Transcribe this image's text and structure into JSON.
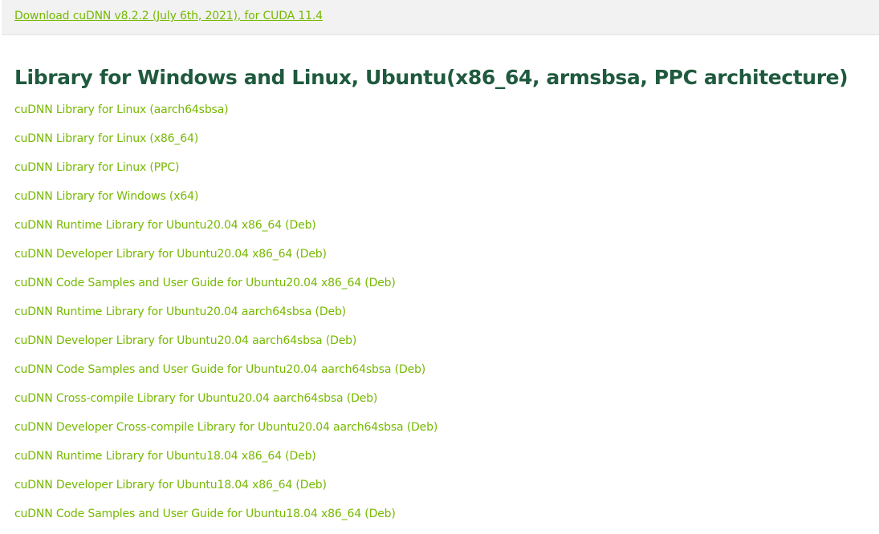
{
  "top_bar": {
    "download_link": "Download cuDNN v8.2.2 (July 6th, 2021), for CUDA 11.4"
  },
  "section": {
    "title": "Library for Windows and Linux, Ubuntu(x86_64, armsbsa, PPC architecture)"
  },
  "links": [
    "cuDNN Library for Linux (aarch64sbsa)",
    "cuDNN Library for Linux (x86_64)",
    "cuDNN Library for Linux (PPC)",
    "cuDNN Library for Windows (x64)",
    "cuDNN Runtime Library for Ubuntu20.04 x86_64 (Deb)",
    "cuDNN Developer Library for Ubuntu20.04 x86_64 (Deb)",
    "cuDNN Code Samples and User Guide for Ubuntu20.04 x86_64 (Deb)",
    "cuDNN Runtime Library for Ubuntu20.04 aarch64sbsa (Deb)",
    "cuDNN Developer Library for Ubuntu20.04 aarch64sbsa (Deb)",
    "cuDNN Code Samples and User Guide for Ubuntu20.04 aarch64sbsa (Deb)",
    "cuDNN Cross-compile Library for Ubuntu20.04 aarch64sbsa (Deb)",
    "cuDNN Developer Cross-compile Library for Ubuntu20.04 aarch64sbsa (Deb)",
    "cuDNN Runtime Library for Ubuntu18.04 x86_64 (Deb)",
    "cuDNN Developer Library for Ubuntu18.04 x86_64 (Deb)",
    "cuDNN Code Samples and User Guide for Ubuntu18.04 x86_64 (Deb)"
  ],
  "colors": {
    "link": "#76b900",
    "title": "#1f5a3e",
    "top_bar_bg": "#f2f2f2"
  }
}
